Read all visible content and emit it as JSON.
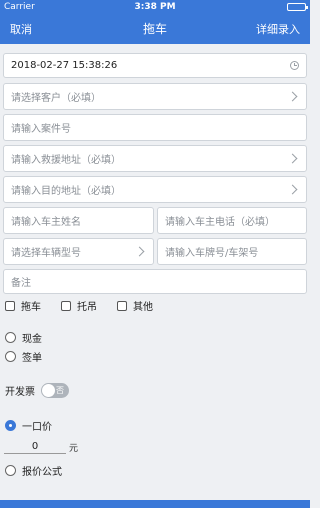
{
  "status_bar": {
    "carrier": "Carrier",
    "time": "3:38 PM"
  },
  "nav": {
    "cancel": "取消",
    "title": "拖车",
    "detail": "详细录入"
  },
  "form": {
    "datetime": "2018-02-27 15:38:26",
    "customer_placeholder": "请选择客户（必填）",
    "case_placeholder": "请输入案件号",
    "rescue_address_placeholder": "请输入救援地址（必填）",
    "destination_placeholder": "请输入目的地址（必填）",
    "owner_name_placeholder": "请输入车主姓名",
    "owner_phone_placeholder": "请输入车主电话（必填）",
    "vehicle_model_placeholder": "请选择车辆型号",
    "plate_placeholder": "请输入车牌号/车架号",
    "remark_placeholder": "备注"
  },
  "service_types": [
    "拖车",
    "托吊",
    "其他"
  ],
  "payment": {
    "cash": "现金",
    "sign": "签单"
  },
  "invoice": {
    "label": "开发票",
    "toggle_text": "否"
  },
  "pricing": {
    "fixed": "一口价",
    "value": "0",
    "unit": "元",
    "formula": "报价公式"
  }
}
